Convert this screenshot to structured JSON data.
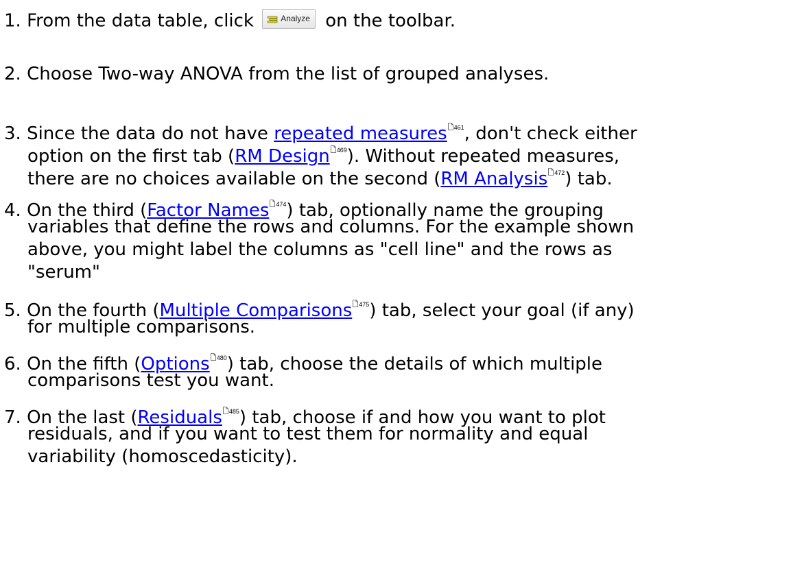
{
  "steps": [
    {
      "number": "1.",
      "lines": [
        [
          {
            "t": "text",
            "v": " From the data table, click "
          },
          {
            "t": "button",
            "v": "Analyze",
            "icon": "analyze-icon"
          },
          {
            "t": "text",
            "v": " on the toolbar."
          }
        ]
      ]
    },
    {
      "number": "2.",
      "lines": [
        [
          {
            "t": "text",
            "v": " Choose Two-way ANOVA from the list of grouped analyses."
          }
        ]
      ]
    },
    {
      "number": "3.",
      "lines": [
        [
          {
            "t": "text",
            "v": " Since the data do not have "
          },
          {
            "t": "link",
            "v": "repeated measures",
            "ref": "461"
          },
          {
            "t": "text",
            "v": ", don't check either"
          }
        ],
        [
          {
            "t": "text",
            "v": "option on the first tab ("
          },
          {
            "t": "link",
            "v": "RM Design",
            "ref": "469"
          },
          {
            "t": "text",
            "v": "). Without repeated measures,"
          }
        ],
        [
          {
            "t": "text",
            "v": "there are no choices available on the second ("
          },
          {
            "t": "link",
            "v": "RM Analysis",
            "ref": "472"
          },
          {
            "t": "text",
            "v": ") tab."
          }
        ]
      ]
    },
    {
      "number": "4.",
      "lines": [
        [
          {
            "t": "text",
            "v": "  On the third ("
          },
          {
            "t": "link",
            "v": "Factor Names",
            "ref": "474"
          },
          {
            "t": "text",
            "v": ") tab, optionally name the grouping"
          }
        ],
        [
          {
            "t": "text",
            "v": "variables that define the rows and columns. For the example shown"
          }
        ],
        [
          {
            "t": "text",
            "v": "above, you might label the columns as \"cell line\" and the rows as"
          }
        ],
        [
          {
            "t": "text",
            "v": "\"serum\""
          }
        ]
      ]
    },
    {
      "number": "5.",
      "lines": [
        [
          {
            "t": "text",
            "v": " On the fourth ("
          },
          {
            "t": "link",
            "v": "Multiple Comparisons",
            "ref": "475"
          },
          {
            "t": "text",
            "v": ") tab, select your goal (if any)"
          }
        ],
        [
          {
            "t": "text",
            "v": "for multiple comparisons."
          }
        ]
      ]
    },
    {
      "number": "6.",
      "lines": [
        [
          {
            "t": "text",
            "v": " On the fifth ("
          },
          {
            "t": "link",
            "v": "Options",
            "ref": "480"
          },
          {
            "t": "text",
            "v": ") tab, choose the details of which multiple"
          }
        ],
        [
          {
            "t": "text",
            "v": "comparisons test you want."
          }
        ]
      ]
    },
    {
      "number": "7.",
      "lines": [
        [
          {
            "t": "text",
            "v": " On the last ("
          },
          {
            "t": "link",
            "v": "Residuals",
            "ref": "485"
          },
          {
            "t": "text",
            "v": ") tab, choose if and how you want to plot"
          }
        ],
        [
          {
            "t": "text",
            "v": "residuals, and if you want to test them for normality and equal"
          }
        ],
        [
          {
            "t": "text",
            "v": "variability (homoscedasticity)."
          }
        ]
      ]
    }
  ],
  "colors": {
    "link": "#0000ff",
    "text": "#000000",
    "button_icon": "#e8d800"
  },
  "icons": {
    "page_ref": "page-icon",
    "analyze": "analyze-icon"
  }
}
